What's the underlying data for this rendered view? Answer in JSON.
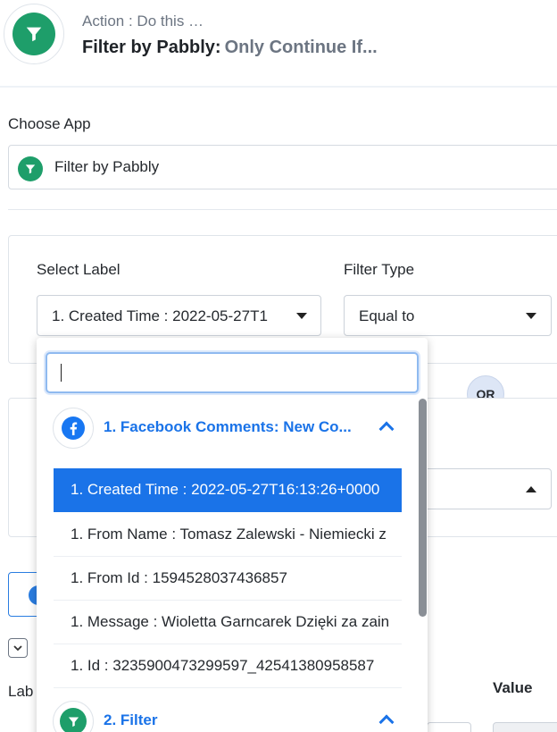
{
  "header": {
    "action_label": "Action : Do this …",
    "title": "Filter by Pabbly:",
    "subtitle": "Only Continue If..."
  },
  "choose_app": {
    "label": "Choose App",
    "selected": "Filter by Pabbly"
  },
  "filter_row": {
    "select_label_heading": "Select Label",
    "select_label_value": "1. Created Time : 2022-05-27T1",
    "filter_type_heading": "Filter Type",
    "filter_type_value": "Equal to"
  },
  "or_badge": "OR",
  "bottom": {
    "label_partial": "Lab",
    "value_heading": "Value"
  },
  "dropdown_panel": {
    "search_value": "",
    "groups": [
      {
        "title": "1. Facebook Comments: New Co...",
        "icon": "facebook-icon",
        "options": [
          "1. Created Time : 2022-05-27T16:13:26+0000",
          "1. From Name : Tomasz Zalewski - Niemiecki z",
          "1. From Id : 1594528037436857",
          "1. Message : Wioletta Garncarek Dzięki za zain",
          "1. Id : 3235900473299597_42541380958587"
        ],
        "selected_index": 0
      },
      {
        "title": "2. Filter",
        "icon": "filter-icon"
      }
    ]
  },
  "colors": {
    "brand_green": "#1e9e6a",
    "accent_blue": "#1a73e8",
    "facebook_blue": "#1877f2"
  }
}
